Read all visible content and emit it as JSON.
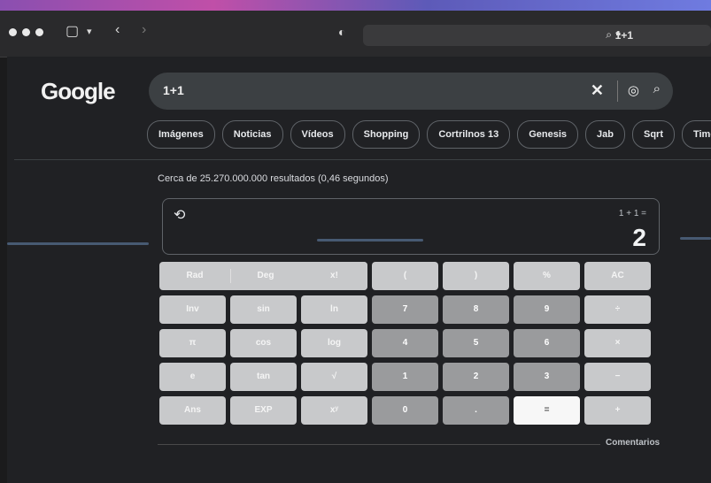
{
  "browser": {
    "url_text": "1+1",
    "url_icons": [
      "search-icon",
      "lock-icon"
    ]
  },
  "google": {
    "logo": "Google",
    "query": "1+1",
    "chips": [
      "Imágenes",
      "Noticias",
      "Vídeos",
      "Shopping",
      "Cortrilnos 13",
      "Genesis",
      "Jab",
      "Sqrt",
      "Timeline"
    ],
    "results_stats": "Cerca de 25.270.000.000 resultados (0,46 segundos)"
  },
  "calculator": {
    "expression": "1 + 1 =",
    "result": "2",
    "keys": {
      "r1": [
        "Rad",
        "Deg",
        "x!",
        "(",
        ")",
        "%",
        "AC"
      ],
      "r2": [
        "Inv",
        "sin",
        "ln",
        "7",
        "8",
        "9",
        "÷"
      ],
      "r3": [
        "π",
        "cos",
        "log",
        "4",
        "5",
        "6",
        "×"
      ],
      "r4": [
        "e",
        "tan",
        "√",
        "1",
        "2",
        "3",
        "−"
      ],
      "r5": [
        "Ans",
        "EXP",
        "xʸ",
        "0",
        ".",
        "=",
        "+"
      ]
    }
  },
  "footer": {
    "comments": "Comentarios"
  },
  "colors": {
    "page_bg": "#202124",
    "numeric_key": "#9a9b9d",
    "function_key": "#c8c9cb",
    "equals_key": "#f7f7f7"
  }
}
